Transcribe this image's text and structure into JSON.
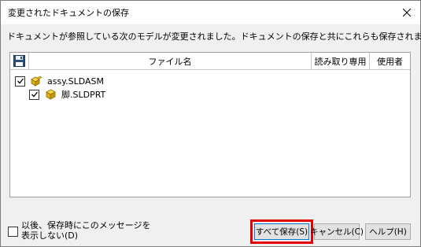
{
  "window": {
    "title": "変更されたドキュメントの保存",
    "close_icon": "close-icon"
  },
  "message": "ドキュメントが参照している次のモデルが変更されました。ドキュメントの保存と共にこれらも保存されます。",
  "table": {
    "columns": [
      "ファイル名",
      "読み取り専用",
      "使用者"
    ],
    "save_column_icon": "floppy-disk-icon",
    "rows": [
      {
        "checked": true,
        "icon": "assembly-icon",
        "name": "assy.SLDASM",
        "readonly": "",
        "user": ""
      },
      {
        "checked": true,
        "icon": "part-icon",
        "name": "脚.SLDPRT",
        "readonly": "",
        "user": ""
      }
    ]
  },
  "dont_show": {
    "checked": false,
    "label_line1": "以後、保存時にこのメッセージを",
    "label_line2": "表示しない(D)"
  },
  "buttons": {
    "save_all": "すべて保存(S)",
    "cancel": "キャンセル(C)",
    "help": "ヘルプ(H)"
  },
  "colors": {
    "highlight": "#e00000",
    "focus_border": "#0078d7",
    "assembly_icon": "#f2c20f",
    "part_icon": "#f2c20f"
  }
}
